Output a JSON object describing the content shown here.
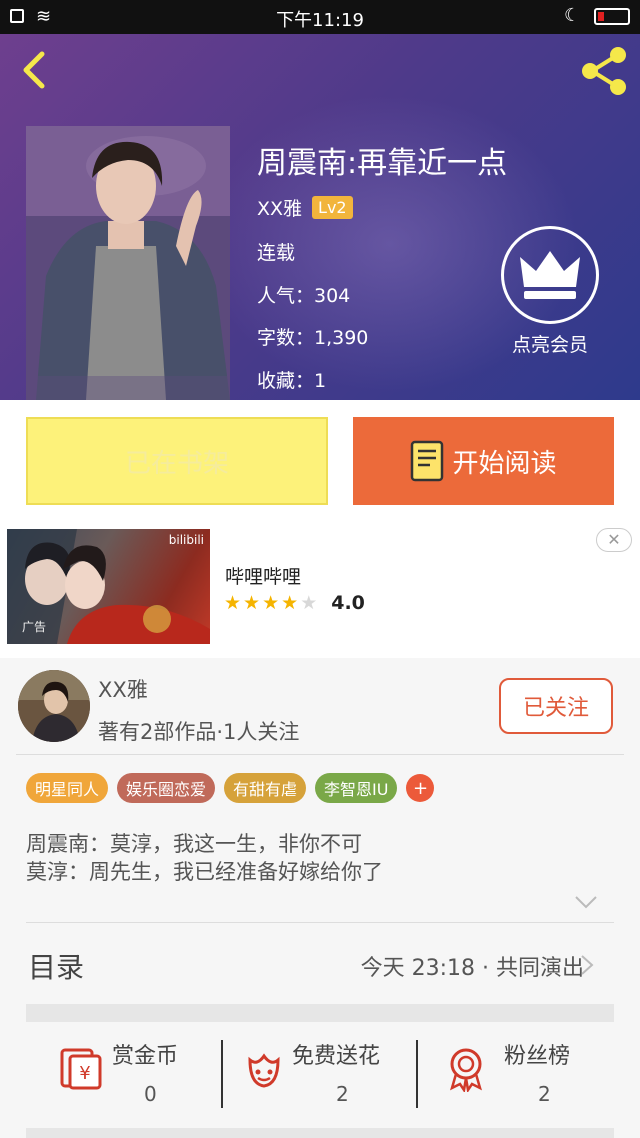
{
  "status_bar": {
    "time": "下午11:19"
  },
  "header": {
    "title": "周震南:再靠近一点",
    "author": "XX雅",
    "level": "Lv2",
    "status": "连载",
    "popularity": "人气：304",
    "word_count": "字数：1,390",
    "favorites": "收藏：1",
    "vip_label": "点亮会员"
  },
  "actions": {
    "shelf_label": "已在书架",
    "read_label": "开始阅读"
  },
  "ad": {
    "name": "哔哩哔哩",
    "rating": "4.0",
    "rating_value": 4.0,
    "brand_mark": "bilibili",
    "tag": "广告"
  },
  "author_section": {
    "name": "XX雅",
    "stats": "著有2部作品·1人关注",
    "follow_label": "已关注",
    "tags": [
      {
        "label": "明星同人",
        "color": "#f0a63a"
      },
      {
        "label": "娱乐圈恋爱",
        "color": "#c06a5a"
      },
      {
        "label": "有甜有虐",
        "color": "#d6a23a"
      },
      {
        "label": "李智恩IU",
        "color": "#7aa848"
      }
    ],
    "tag_more": "+",
    "synopsis": [
      "周震南：莫淳，我这一生，非你不可",
      "莫淳：周先生，我已经准备好嫁给你了"
    ]
  },
  "toc": {
    "label": "目录",
    "latest": "今天 23:18 · 共同演出"
  },
  "stats": [
    {
      "label": "赏金币",
      "value": "0",
      "icon": "coin-envelope-icon"
    },
    {
      "label": "免费送花",
      "value": "2",
      "icon": "flower-icon"
    },
    {
      "label": "粉丝榜",
      "value": "2",
      "icon": "medal-icon"
    }
  ],
  "colors": {
    "accent": "#ec6a3a",
    "shelf_button": "#fdf27a",
    "header_gradient_start": "#6e3f8e",
    "header_gradient_end": "#2e3a8c"
  }
}
